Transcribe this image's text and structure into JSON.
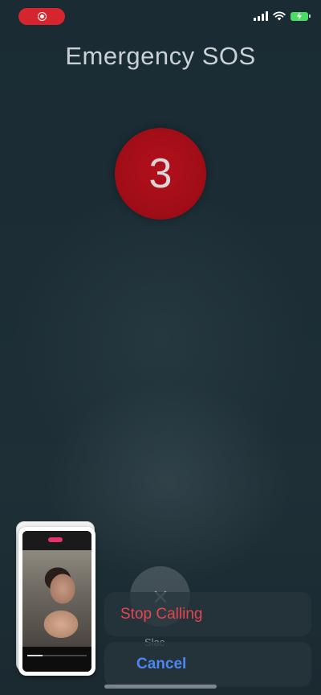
{
  "status_bar": {
    "recording_indicator": "screen-recording",
    "icons": [
      "cellular-signal-icon",
      "wifi-icon",
      "battery-charging-icon"
    ]
  },
  "sos": {
    "title": "Emergency SOS",
    "countdown": "3"
  },
  "slider": {
    "ghost_label": "Slac"
  },
  "sheet": {
    "stop_label": "Stop Calling",
    "cancel_label": "Cancel"
  },
  "colors": {
    "countdown_red": "#a80e18",
    "destructive_red": "#e5454f",
    "cancel_blue": "#4c87ef",
    "battery_green": "#4cd964",
    "recording_red": "#d5252f"
  }
}
